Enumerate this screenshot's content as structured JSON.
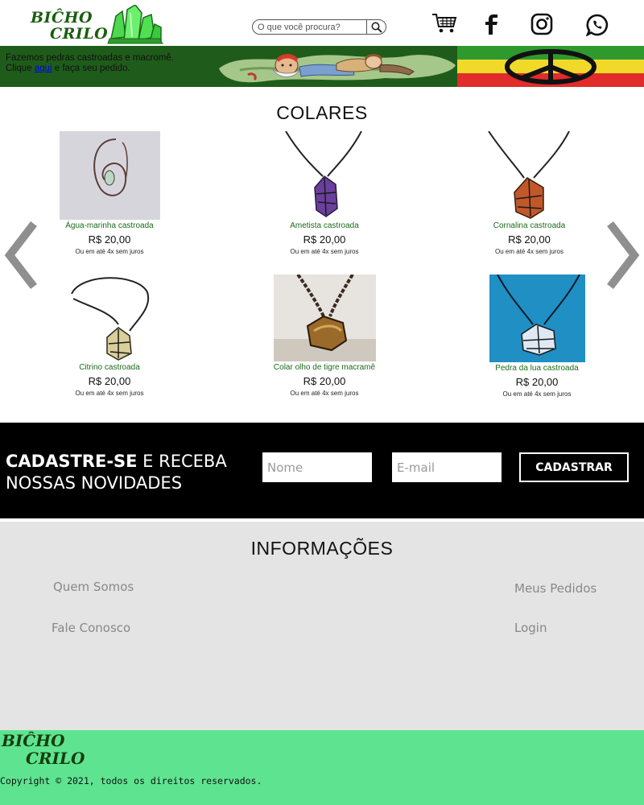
{
  "header": {
    "logo_line1": "BIĈHO",
    "logo_line2": "CRILO",
    "search_placeholder": "O que você procura?",
    "icons": [
      "search-icon",
      "cart-icon",
      "facebook-icon",
      "instagram-icon",
      "whatsapp-icon"
    ]
  },
  "banner": {
    "line1": "Fazemos pedras castroadas e macromê.",
    "line2_pre": "Clique ",
    "line2_link": "aqui",
    "line2_post": " e faça seu pedido."
  },
  "products": {
    "title": "COLARES",
    "items": [
      {
        "name": "Água-marinha castroada",
        "price": "R$ 20,00",
        "installments": "Ou em até 4x sem juros"
      },
      {
        "name": "Ametista castroada",
        "price": "R$ 20,00",
        "installments": "Ou em até 4x sem juros"
      },
      {
        "name": "Cornalina castroada",
        "price": "R$ 20,00",
        "installments": "Ou em até 4x sem juros"
      },
      {
        "name": "Citrino castroada",
        "price": "R$ 20,00",
        "installments": "Ou em até 4x sem juros"
      },
      {
        "name": "Colar olho de tigre macramê",
        "price": "R$ 20,00",
        "installments": "Ou em até 4x sem juros"
      },
      {
        "name": "Pedra da lua castroada",
        "price": "R$ 20,00",
        "installments": "Ou em até 4x sem juros"
      }
    ]
  },
  "newsletter": {
    "title_bold": "CADASTRE-SE",
    "title_rest": " E RECEBA",
    "title_line2": "NOSSAS NOVIDADES",
    "name_placeholder": "Nome",
    "email_placeholder": "E-mail",
    "button": "CADASTRAR"
  },
  "info": {
    "title": "INFORMAÇÕES",
    "links": {
      "about": "Quem Somos",
      "contact": "Fale Conosco",
      "orders": "Meus Pedidos",
      "login": "Login"
    }
  },
  "footer": {
    "logo_line1": "BIĈHO",
    "logo_line2": "CRILO",
    "copyright": "Copyright © 2021, todos os direitos reservados."
  },
  "colors": {
    "brand_green": "#5ee490",
    "banner_green": "#1f5c1b",
    "product_name": "#1a6b1a",
    "newsletter_bg": "#000000",
    "info_bg": "#e4e4e4"
  }
}
